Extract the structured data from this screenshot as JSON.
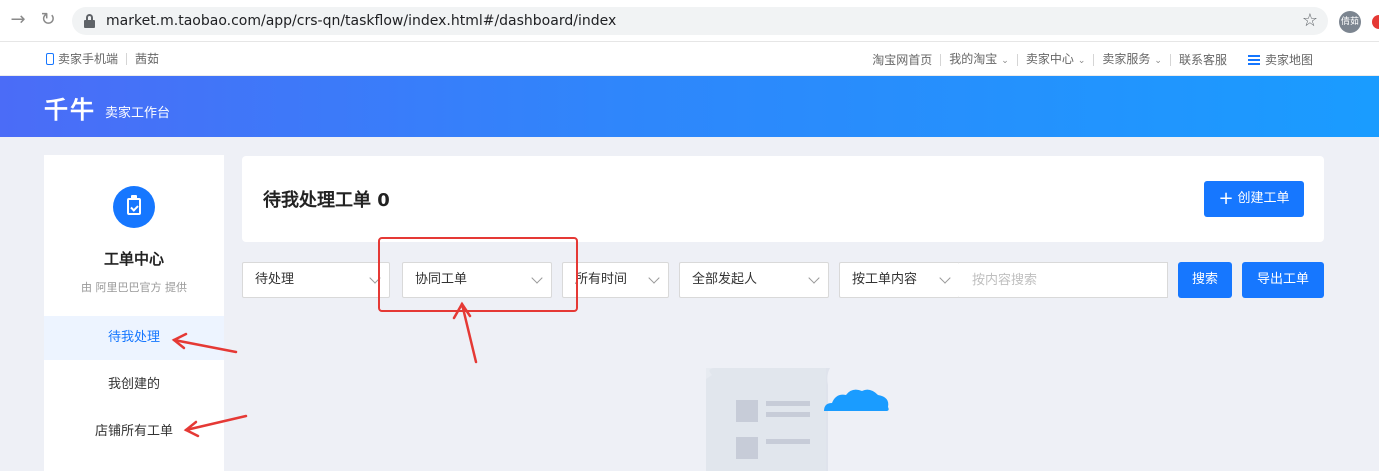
{
  "browser": {
    "url": "market.m.taobao.com/app/crs-qn/taskflow/index.html#/dashboard/index",
    "profile_initials": "倩茹"
  },
  "topbar": {
    "left": [
      "卖家手机端",
      "茜茹"
    ],
    "right": [
      {
        "label": "淘宝网首页",
        "caret": false
      },
      {
        "label": "我的淘宝",
        "caret": true
      },
      {
        "label": "卖家中心",
        "caret": true
      },
      {
        "label": "卖家服务",
        "caret": true
      },
      {
        "label": "联系客服",
        "caret": false
      }
    ],
    "sitemap": "卖家地图"
  },
  "header": {
    "logo": "千牛",
    "subtitle": "卖家工作台"
  },
  "sidebar": {
    "title": "工单中心",
    "subtitle": "由 阿里巴巴官方 提供",
    "items": [
      {
        "label": "待我处理",
        "active": true
      },
      {
        "label": "我创建的",
        "active": false
      },
      {
        "label": "店铺所有工单",
        "active": false
      }
    ]
  },
  "main": {
    "title": "待我处理工单 0",
    "create_label": "创建工单"
  },
  "filters": {
    "status": "待处理",
    "type": "协同工单",
    "time": "所有时间",
    "initiator": "全部发起人",
    "search_field": "按工单内容",
    "search_placeholder": "按内容搜索",
    "search_label": "搜索",
    "export_label": "导出工单"
  },
  "colors": {
    "primary": "#1677ff",
    "annotation": "#e53935"
  }
}
